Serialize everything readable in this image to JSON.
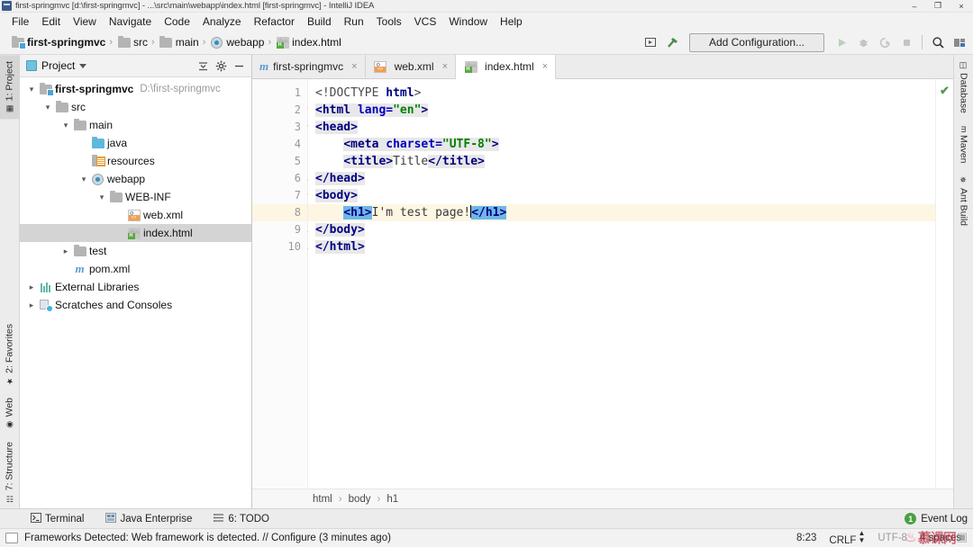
{
  "window": {
    "title": "first-springmvc [d:\\first-springmvc] - ...\\src\\main\\webapp\\index.html [first-springmvc] - IntelliJ IDEA",
    "minimize": "–",
    "maximize": "❐",
    "close": "×"
  },
  "menubar": {
    "items": [
      "File",
      "Edit",
      "View",
      "Navigate",
      "Code",
      "Analyze",
      "Refactor",
      "Build",
      "Run",
      "Tools",
      "VCS",
      "Window",
      "Help"
    ]
  },
  "navbar": {
    "breadcrumbs": [
      {
        "label": "first-springmvc",
        "icon": "project-folder-icon"
      },
      {
        "label": "src",
        "icon": "folder-icon"
      },
      {
        "label": "main",
        "icon": "folder-icon"
      },
      {
        "label": "webapp",
        "icon": "webapp-folder-icon"
      },
      {
        "label": "index.html",
        "icon": "html-file-icon"
      }
    ],
    "separator": "›",
    "add_configuration_label": "Add Configuration...",
    "icons": [
      "select-in-icon",
      "build-hammer-icon",
      "run-icon",
      "debug-icon",
      "run-coverage-icon",
      "stop-icon",
      "search-icon",
      "project-structure-icon"
    ]
  },
  "left_strip": {
    "tabs": [
      {
        "label": "1: Project",
        "active": true,
        "icon": "project-icon"
      },
      {
        "label": "2: Favorites",
        "active": false,
        "icon": "star-icon"
      },
      {
        "label": "Web",
        "active": false,
        "icon": "globe-icon"
      },
      {
        "label": "7: Structure",
        "active": false,
        "icon": "structure-icon"
      }
    ]
  },
  "right_strip": {
    "tabs": [
      {
        "label": "Database",
        "icon": "database-icon"
      },
      {
        "label": "Maven",
        "icon": "maven-icon"
      },
      {
        "label": "Ant Build",
        "icon": "ant-icon"
      }
    ]
  },
  "project_panel": {
    "title": "Project",
    "collapse_all_tooltip": "Collapse All",
    "settings_tooltip": "Settings",
    "hide_tooltip": "Hide",
    "tree": [
      {
        "label": "first-springmvc",
        "sublabel": "D:\\first-springmvc",
        "indent": 0,
        "arrow": "expanded",
        "icon": "project-folder-icon",
        "bold": true,
        "selected": false
      },
      {
        "label": "src",
        "sublabel": "",
        "indent": 1,
        "arrow": "expanded",
        "icon": "folder-icon",
        "bold": false,
        "selected": false
      },
      {
        "label": "main",
        "sublabel": "",
        "indent": 2,
        "arrow": "expanded",
        "icon": "folder-icon",
        "bold": false,
        "selected": false
      },
      {
        "label": "java",
        "sublabel": "",
        "indent": 3,
        "arrow": "none",
        "icon": "source-folder-icon",
        "bold": false,
        "selected": false
      },
      {
        "label": "resources",
        "sublabel": "",
        "indent": 3,
        "arrow": "none",
        "icon": "resources-folder-icon",
        "bold": false,
        "selected": false
      },
      {
        "label": "webapp",
        "sublabel": "",
        "indent": 3,
        "arrow": "expanded",
        "icon": "webapp-folder-icon",
        "bold": false,
        "selected": false
      },
      {
        "label": "WEB-INF",
        "sublabel": "",
        "indent": 4,
        "arrow": "expanded",
        "icon": "folder-icon",
        "bold": false,
        "selected": false
      },
      {
        "label": "web.xml",
        "sublabel": "",
        "indent": 5,
        "arrow": "none",
        "icon": "xml-file-icon",
        "bold": false,
        "selected": false
      },
      {
        "label": "index.html",
        "sublabel": "",
        "indent": 5,
        "arrow": "none",
        "icon": "html-file-icon",
        "bold": false,
        "selected": true
      },
      {
        "label": "test",
        "sublabel": "",
        "indent": 2,
        "arrow": "collapsed",
        "icon": "folder-icon",
        "bold": false,
        "selected": false
      },
      {
        "label": "pom.xml",
        "sublabel": "",
        "indent": 2,
        "arrow": "none",
        "icon": "maven-file-icon",
        "bold": false,
        "selected": false
      },
      {
        "label": "External Libraries",
        "sublabel": "",
        "indent": 0,
        "arrow": "collapsed",
        "icon": "libraries-icon",
        "bold": false,
        "selected": false
      },
      {
        "label": "Scratches and Consoles",
        "sublabel": "",
        "indent": 0,
        "arrow": "collapsed",
        "icon": "scratches-icon",
        "bold": false,
        "selected": false
      }
    ]
  },
  "editor": {
    "tabs": [
      {
        "label": "first-springmvc",
        "icon": "maven-file-icon",
        "active": false
      },
      {
        "label": "web.xml",
        "icon": "xml-file-icon",
        "active": false
      },
      {
        "label": "index.html",
        "icon": "html-file-icon",
        "active": true
      }
    ],
    "close_glyph": "×",
    "line_numbers": [
      "1",
      "2",
      "3",
      "4",
      "5",
      "6",
      "7",
      "8",
      "9",
      "10"
    ],
    "highlighted_line": 8,
    "inspection_status": "✔",
    "breadcrumbs": [
      "html",
      "body",
      "h1"
    ],
    "breadcrumb_separator": "›",
    "code_lines": [
      {
        "n": 1,
        "text": "<!DOCTYPE html>"
      },
      {
        "n": 2,
        "text": "<html lang=\"en\">"
      },
      {
        "n": 3,
        "text": "<head>"
      },
      {
        "n": 4,
        "text": "    <meta charset=\"UTF-8\">"
      },
      {
        "n": 5,
        "text": "    <title>Title</title>"
      },
      {
        "n": 6,
        "text": "</head>"
      },
      {
        "n": 7,
        "text": "<body>"
      },
      {
        "n": 8,
        "text": "    <h1>I'm test page!</h1>"
      },
      {
        "n": 9,
        "text": "</body>"
      },
      {
        "n": 10,
        "text": "</html>"
      }
    ],
    "tokens": {
      "doctype_open": "<!DOCTYPE ",
      "doctype_name": "html",
      "gt": ">",
      "html_open": "<html ",
      "lang_attr": "lang=",
      "lang_value": "\"en\"",
      "head_open": "<head>",
      "meta_open": "<meta ",
      "charset_attr": "charset=",
      "charset_value": "\"UTF-8\"",
      "title_open": "<title>",
      "title_text": "Title",
      "title_close": "</title>",
      "head_close": "</head>",
      "body_open": "<body>",
      "h1_open": "<h1>",
      "h1_text": "I'm test page!",
      "h1_close": "</h1>",
      "body_close": "</body>",
      "html_close": "</html>",
      "indent4": "    "
    }
  },
  "bottom_strip": {
    "tabs": [
      {
        "label": "Terminal",
        "icon": "terminal-icon"
      },
      {
        "label": "Java Enterprise",
        "icon": "java-enterprise-icon"
      },
      {
        "label": "6: TODO",
        "icon": "todo-icon"
      }
    ]
  },
  "statusbar": {
    "message": "Frameworks Detected: Web framework is detected. // Configure (3 minutes ago)",
    "event_log": "Event Log",
    "event_log_count": "1",
    "caret_position": "8:23",
    "line_separator": "CRLF",
    "encoding": "UTF-8",
    "indent": "4 spaces"
  },
  "watermark": {
    "text": "慕课网"
  },
  "colors": {
    "accent_blue": "#3c5a8c",
    "selection_blue": "#6fb6e8",
    "highlight_line": "#fdf6e3",
    "tag_navy": "#000080",
    "value_green": "#008000",
    "ok_green": "#49a03f",
    "watermark_red": "#c0394b"
  }
}
